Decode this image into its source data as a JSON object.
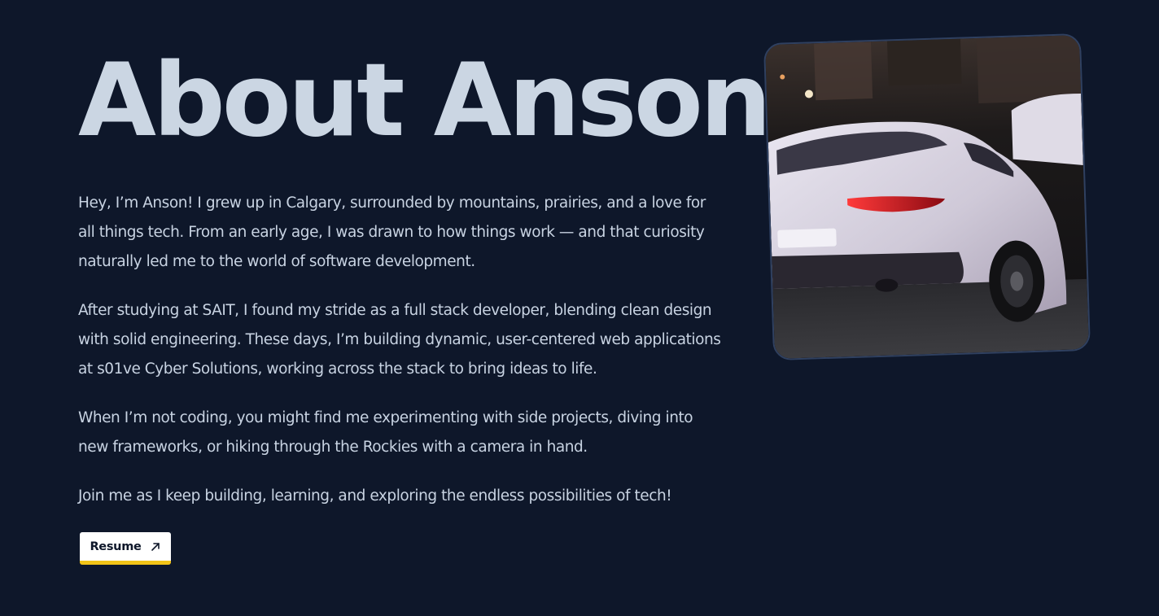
{
  "about": {
    "title": "About Anson",
    "paragraphs": [
      "Hey, I’m Anson! I grew up in Calgary, surrounded by mountains, prairies, and a love for all things tech. From an early age, I was drawn to how things work — and that curiosity naturally led me to the world of software development.",
      "After studying at SAIT, I found my stride as a full stack developer, blending clean design with solid engineering. These days, I’m building dynamic, user-centered web applications at s01ve Cyber Solutions, working across the stack to bring ideas to life.",
      "When I’m not coding, you might find me experimenting with side projects, diving into new frameworks, or hiking through the Rockies with a camera in hand.",
      "Join me as I keep building, learning, and exploring the endless possibilities of tech!"
    ],
    "resume_label": "Resume",
    "resume_icon": "arrow-up-right-icon"
  },
  "photo": {
    "subject": "white sports car photo"
  },
  "colors": {
    "background": "#0e172a",
    "text": "#c8d3e2",
    "title": "#cbd6e3",
    "button_bg": "#ffffff",
    "button_accent": "#f2c418",
    "photo_border": "#2f4060"
  }
}
